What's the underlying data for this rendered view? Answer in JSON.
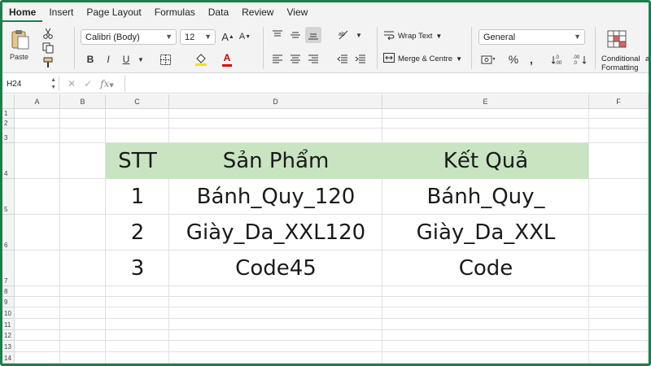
{
  "tabs": [
    "Home",
    "Insert",
    "Page Layout",
    "Formulas",
    "Data",
    "Review",
    "View"
  ],
  "ribbon": {
    "paste_label": "Paste",
    "font_name": "Calibri (Body)",
    "font_size": "12",
    "wrap_text": "Wrap Text",
    "merge_centre": "Merge & Centre",
    "number_format": "General",
    "conditional": "Conditional",
    "formatting": "Formatting",
    "cut_a": "a",
    "bold": "B",
    "italic": "I",
    "underline": "U",
    "grow_font": "A",
    "shrink_font": "A",
    "font_color": "A"
  },
  "formula_bar": {
    "name_box": "H24",
    "fx": "fx",
    "formula": ""
  },
  "columns": [
    "A",
    "B",
    "C",
    "D",
    "E",
    "F"
  ],
  "rows": [
    "1",
    "2",
    "3",
    "4",
    "5",
    "6",
    "7",
    "8",
    "9",
    "10",
    "11",
    "12",
    "13",
    "14"
  ],
  "table": {
    "headers": [
      "STT",
      "Sản Phẩm",
      "Kết Quả"
    ],
    "rows": [
      [
        "1",
        "Bánh_Quy_120",
        "Bánh_Quy_"
      ],
      [
        "2",
        "Giày_Da_XXL120",
        "Giày_Da_XXL"
      ],
      [
        "3",
        "Code45",
        "Code"
      ]
    ]
  },
  "colors": {
    "accent": "#1e7d4a",
    "header_fill": "#c9e4c1"
  }
}
